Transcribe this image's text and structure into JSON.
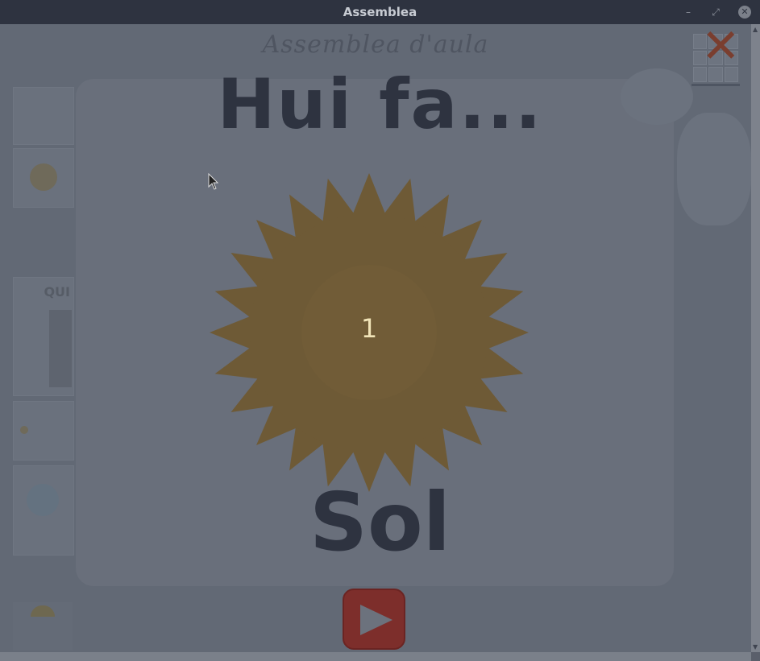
{
  "window": {
    "title": "Assemblea",
    "minimize_glyph": "–",
    "maximize_glyph": "⤢",
    "close_glyph": "✕"
  },
  "app": {
    "title": "Assemblea d'aula",
    "close_glyph": "✕"
  },
  "sidebar": {
    "cards": [
      {
        "label": ""
      },
      {
        "label": ""
      },
      {
        "label": "QUI"
      },
      {
        "label": ""
      },
      {
        "label": ""
      },
      {
        "label": ""
      }
    ]
  },
  "dialog": {
    "heading": "Hui fa...",
    "counter": "1",
    "weather": "Sol"
  },
  "icons": {
    "sun": "sun-icon",
    "play": "play-icon",
    "grid": "grid-icon",
    "cursor": "mouse-cursor"
  },
  "colors": {
    "overlay": "#5a5f6b",
    "sun": "#6e5a36",
    "heading": "#2e3340",
    "play": "#7d2e2b",
    "close": "#7a3e2f"
  }
}
